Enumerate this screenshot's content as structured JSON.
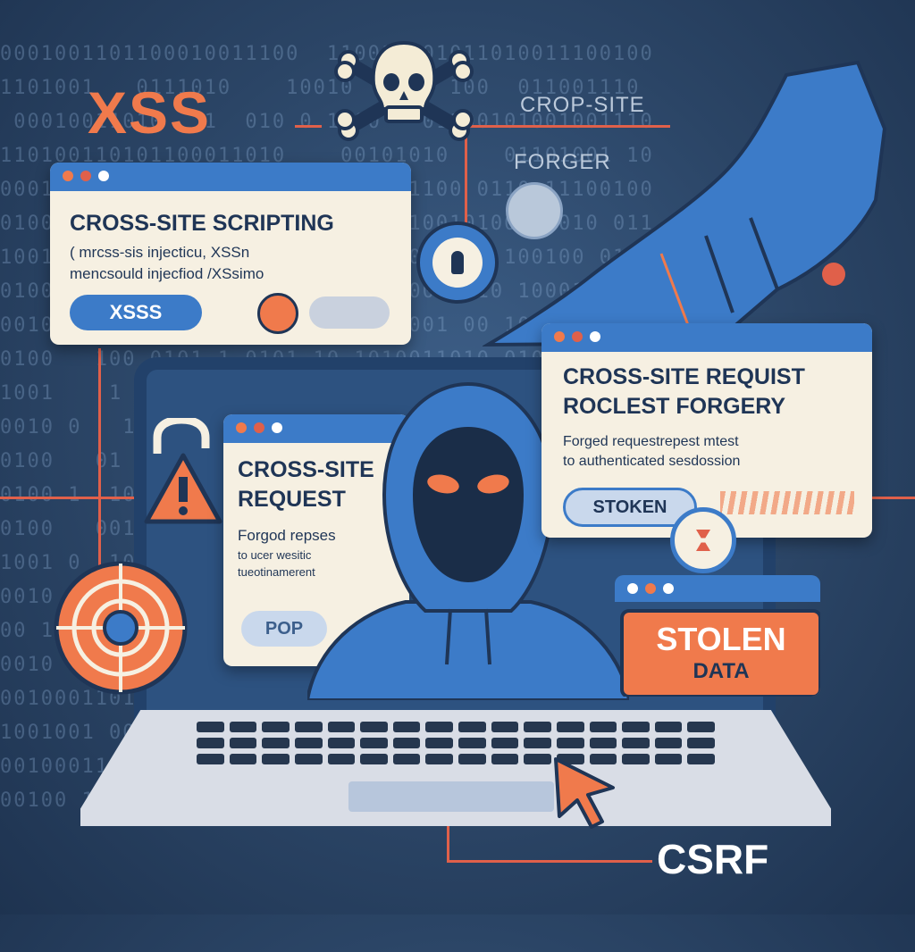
{
  "background_binary": "0001001101100010011100  110010101011010011100100\n1101001   0111010    10010  1001 100  011001110\n 00010011010   1  010 0 1000   01100101001001110\n110100110101100011010    00101010    01101001 10\n0001001 0100   00110100 1101011100 0110 11100100\n01001010 100 0011   001010 10010010100011010 011\n1001001  010   0010 1 100010  010001 100100 010\n01001 0 1010 10101 0100 0 110 0001110 100010 011\n0010  1001 01001 01 01101 10 1001 00 10101 01001\n0100   100 0101 1 0101 10 1010011010 010 100 110\n1001    1 010 0   101 010 0 1001 00 01 10 0 0010\n0010 0   1001 010 010 1 01 011 0110 010 1010 0100\n0100   01 1001 0   01 0101 10 1010 0101 01 0 0100\n0100 1  100 0101   10 01 0001 1001 0100 0101 0100\n0100   001 0010   0 101 1001 0 10 01 0110 0001011\n1001 0  10010 1 0101 0 0110 100 01 1001 0 1 0011\n0010  100 1001 01 0101 1 010 1001 01 0100 0011001\n00 100 0 1001 01 0 101 00 0101 01 0 1001 00 01011\n0010   100 0101 0 1001 0 1000 10 00 100 0010 01100\n0010001101001010 100 001011011 1001 01 0011101001\n1001001 00 1000100 010110100110100101 100 01011010\n0010001101001011101001 00110100 0011 010 0101000101\n00100 100110100101100101 01 1010101 0010 01011 0101",
  "title_xss": "XSS",
  "label_cross_site": "CROP-SITE",
  "label_forger": "FORGER",
  "csrf_label": "CSRF",
  "xss_window": {
    "heading": "CROSS-SITE SCRIPTING",
    "line1": "( mrcss-sis injecticu, XSSn",
    "line2": "mencsould injecfiod /XSsimo",
    "button": "XSSS"
  },
  "csrf_window_large": {
    "heading_line1": "CROSS-SITE REQUIST",
    "heading_line2": "ROCLEST FORGERY",
    "line1": "Forged requestrepest mtest",
    "line2": "to authenticated sesdossion",
    "button": "STOKEN"
  },
  "csrf_window_small": {
    "heading_line1": "CROSS-SITE",
    "heading_line2": "REQUEST",
    "line1": "Forgod repses",
    "line2": "to ucer wesitic",
    "line3": "tueotinamerent",
    "button": "POP"
  },
  "stolen_window": {
    "line1": "STOLEN",
    "line2": "DATA"
  },
  "colors": {
    "accent_orange": "#f07a4c",
    "accent_red": "#e0604a",
    "brand_blue": "#3c7bc8",
    "panel_cream": "#f6f0e2",
    "navy": "#1f3556"
  },
  "icons": [
    "skull-crossbones-icon",
    "padlock-keyhole-icon",
    "warning-icon",
    "open-lock-icon",
    "target-icon",
    "cursor-arrow-icon",
    "hooded-hacker",
    "pointing-hand"
  ]
}
